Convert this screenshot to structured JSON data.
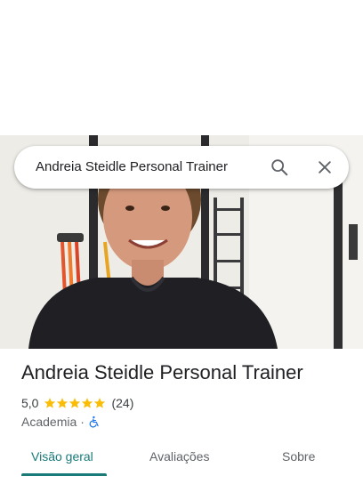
{
  "search": {
    "query": "Andreia Steidle Personal Trainer",
    "search_icon": "search-icon",
    "close_icon": "close-icon"
  },
  "place": {
    "name": "Andreia Steidle Personal Trainer",
    "rating": "5,0",
    "stars": 5,
    "review_count": "(24)",
    "category": "Academia",
    "separator": "·",
    "accessibility_icon": "wheelchair-accessible-icon"
  },
  "tabs": [
    {
      "label": "Visão geral",
      "active": true
    },
    {
      "label": "Avaliações",
      "active": false
    },
    {
      "label": "Sobre",
      "active": false
    }
  ],
  "colors": {
    "accent": "#1a7a7a",
    "star": "#fbbc04",
    "accessibility": "#1a73e8"
  }
}
